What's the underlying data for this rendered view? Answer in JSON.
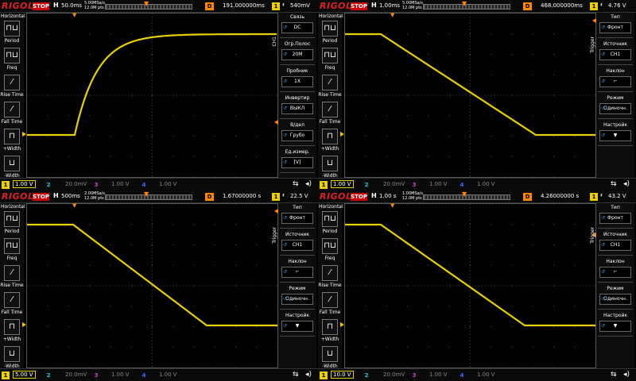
{
  "logo": "RIGOL",
  "run_state": "STOP",
  "h_label": "H",
  "d_label": "D",
  "trigger_channel": "1",
  "trigger_edge": "ᶠ",
  "left_menu": {
    "title": "Horizontal",
    "items": [
      "Period",
      "Freq",
      "Rise Time",
      "Fall Time",
      "+Width",
      "-Width"
    ]
  },
  "channels": {
    "ch2": {
      "label": "2",
      "value": "20.0mV"
    },
    "ch3": {
      "label": "3",
      "value": "1.00 V"
    },
    "ch4": {
      "label": "4",
      "value": "1.00 V"
    }
  },
  "colors": {
    "ch1": "#e8d000",
    "ch2": "#20c8d8",
    "ch3": "#d040d0",
    "ch4": "#3070ff",
    "trigger": "#ff8800",
    "logo": "#dd2222"
  },
  "panels": [
    {
      "timebase": "50.0ms",
      "sample_rate": "5.00MSa/s",
      "memory_depth": "12.0M pts",
      "delay": "191.000000ms",
      "trigger_level": "540mV",
      "ch1_scale": "1.00 V",
      "side_menu_title": "CH1",
      "side_menu": [
        {
          "label": "Связь",
          "value": "DC"
        },
        {
          "label": "Огр.Полос",
          "value": "20M"
        },
        {
          "label": "Пробник",
          "value": "1X"
        },
        {
          "label": "Инвертир",
          "value": "ВЫКЛ"
        },
        {
          "label": "В/дел",
          "value": "Грубо"
        },
        {
          "label": "Ед.измер.",
          "value": "[V]"
        }
      ]
    },
    {
      "timebase": "1.00ms",
      "sample_rate": "5.00MSa/s",
      "memory_depth": "12.0M pts",
      "delay": "468.000000ms",
      "trigger_level": "4.76 V",
      "ch1_scale": "1.00 V",
      "side_menu_title": "Trigger",
      "side_menu": [
        {
          "label": "Тип",
          "value": "Фронт"
        },
        {
          "label": "Источник",
          "value": "CH1"
        },
        {
          "label": "Наклон",
          "value": "⌐"
        },
        {
          "label": "Режим",
          "value": "Одиночн."
        },
        {
          "label": "Настройк",
          "value": "▼"
        }
      ]
    },
    {
      "timebase": "500ms",
      "sample_rate": "2.00MSa/s",
      "memory_depth": "12.0M pts",
      "delay": "1.67000000 s",
      "trigger_level": "22.5 V",
      "ch1_scale": "5.00 V",
      "side_menu_title": "Trigger",
      "side_menu": [
        {
          "label": "Тип",
          "value": "Фронт"
        },
        {
          "label": "Источник",
          "value": "CH1"
        },
        {
          "label": "Наклон",
          "value": "⌐"
        },
        {
          "label": "Режим",
          "value": "Одиночн."
        },
        {
          "label": "Настройк",
          "value": "▼"
        }
      ]
    },
    {
      "timebase": "1.00 s",
      "sample_rate": "1.00MSa/s",
      "memory_depth": "12.0M pts",
      "delay": "4.26000000 s",
      "trigger_level": "43.2 V",
      "ch1_scale": "10.0 V",
      "side_menu_title": "Trigger",
      "side_menu": [
        {
          "label": "Тип",
          "value": "Фронт"
        },
        {
          "label": "Источник",
          "value": "CH1"
        },
        {
          "label": "Наклон",
          "value": "⌐"
        },
        {
          "label": "Режим",
          "value": "Одиночн."
        },
        {
          "label": "Настройк",
          "value": "▼"
        }
      ]
    }
  ]
}
